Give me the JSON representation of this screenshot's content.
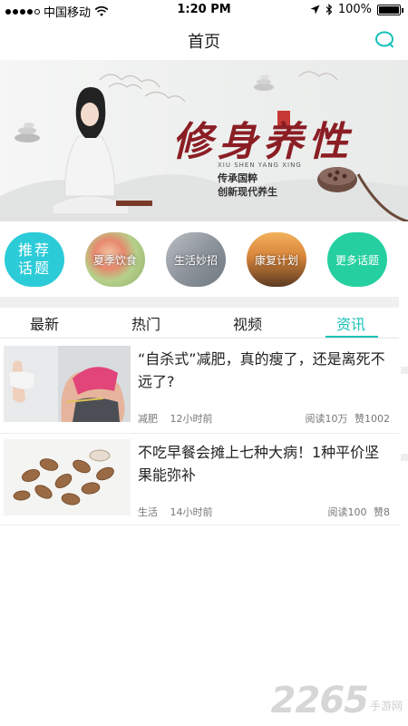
{
  "status_bar": {
    "carrier": "中国移动",
    "time": "1:20 PM",
    "battery": "100%",
    "signal_icon": "signal-dots-icon",
    "wifi_icon": "wifi-icon",
    "location_icon": "location-arrow-icon",
    "bluetooth_icon": "bluetooth-icon",
    "battery_level": 1.0
  },
  "nav": {
    "title": "首页",
    "search_icon": "search-icon",
    "accent": "#19c2b8"
  },
  "banner": {
    "headline": "修身养性",
    "pinyin": "XIU SHEN YANG XING",
    "line1": "传承国粹",
    "line2": "创新现代养生",
    "seal": "修身"
  },
  "categories": [
    {
      "label_line1": "推荐",
      "label_line2": "话题",
      "color": "#2ccbd8"
    },
    {
      "label": "夏季饮食"
    },
    {
      "label": "生活妙招"
    },
    {
      "label": "康复计划"
    },
    {
      "label": "更多话题",
      "color": "#26cfa0"
    }
  ],
  "tabs": [
    {
      "label": "最新",
      "active": false
    },
    {
      "label": "热门",
      "active": false
    },
    {
      "label": "视频",
      "active": false
    },
    {
      "label": "资讯",
      "active": true
    }
  ],
  "articles": [
    {
      "title": "“自杀式”减肥，真的瘦了，还是离死不远了?",
      "tag": "减肥",
      "time": "12小时前",
      "reads": "阅读10万",
      "likes": "赞1002"
    },
    {
      "title": "不吃早餐会摊上七种大病！1种平价坚果能弥补",
      "tag": "生活",
      "time": "14小时前",
      "reads": "阅读100",
      "likes": "赞8"
    }
  ],
  "watermark": {
    "number": "2265",
    "text": "手游网"
  }
}
